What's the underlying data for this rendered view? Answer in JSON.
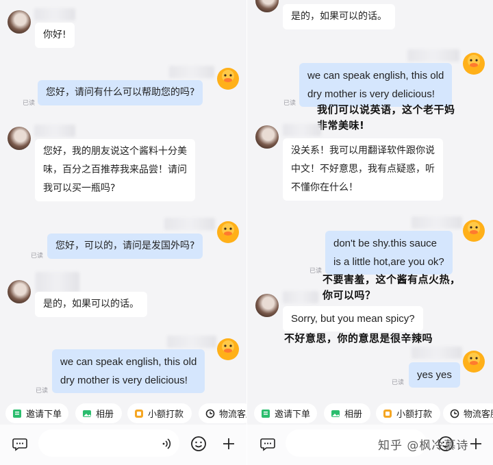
{
  "left_panel": {
    "read_label": "已读",
    "messages": [
      {
        "side": "in",
        "text": "你好!"
      },
      {
        "side": "out",
        "text": "您好，请问有什么可以帮助您的吗?"
      },
      {
        "side": "in",
        "lines": [
          "您好，我的朋友说这个酱料十分美",
          "味，百分之百推荐我来品尝！请问",
          "我可以买一瓶吗?"
        ]
      },
      {
        "side": "out",
        "text": "您好，可以的，请问是发国外吗?"
      },
      {
        "side": "in",
        "text": "是的，如果可以的话。"
      },
      {
        "side": "out",
        "lines": [
          "we can speak english, this old",
          "dry mother is very delicious!"
        ]
      }
    ]
  },
  "right_panel": {
    "read_label": "已读",
    "messages": [
      {
        "side": "in",
        "text": "是的，如果可以的话。"
      },
      {
        "side": "out",
        "lines": [
          "we can speak english, this old",
          "dry mother is very delicious!"
        ],
        "caption_lines": [
          "我们可以说英语，这个老干妈",
          "非常美味!"
        ]
      },
      {
        "side": "in",
        "lines": [
          "没关系！我可以用翻译软件跟你说",
          "中文！不好意思，我有点疑惑，听",
          "不懂你在什么！"
        ]
      },
      {
        "side": "out",
        "lines": [
          "don't be shy.this sauce",
          "is a little hot,are you ok?"
        ],
        "caption_lines": [
          "不要害羞，这个酱有点火热，",
          "你可以吗？"
        ]
      },
      {
        "side": "in",
        "text": "Sorry, but you mean spicy?",
        "caption": "不好意思，你的意思是很辛辣吗"
      },
      {
        "side": "out",
        "text": "yes yes"
      }
    ]
  },
  "toolbar": {
    "items": [
      {
        "label": "邀请下单",
        "icon": "order-icon"
      },
      {
        "label": "相册",
        "icon": "album-icon"
      },
      {
        "label": "小额打款",
        "icon": "payment-icon"
      },
      {
        "label": "物流客服",
        "icon": "logistics-icon"
      }
    ]
  },
  "input_bar": {
    "left_icon": "chat-bubble-icon",
    "right_icons": [
      "voice-icon",
      "emoji-icon",
      "plus-icon"
    ]
  },
  "watermark": "知乎 @枫冷慕诗",
  "colors": {
    "background": "#f4f4f6",
    "outgoing_bubble": "#d5e6fd",
    "incoming_bubble": "#ffffff",
    "toolbar_green": "#2bbd6e",
    "toolbar_orange": "#f5a623"
  }
}
